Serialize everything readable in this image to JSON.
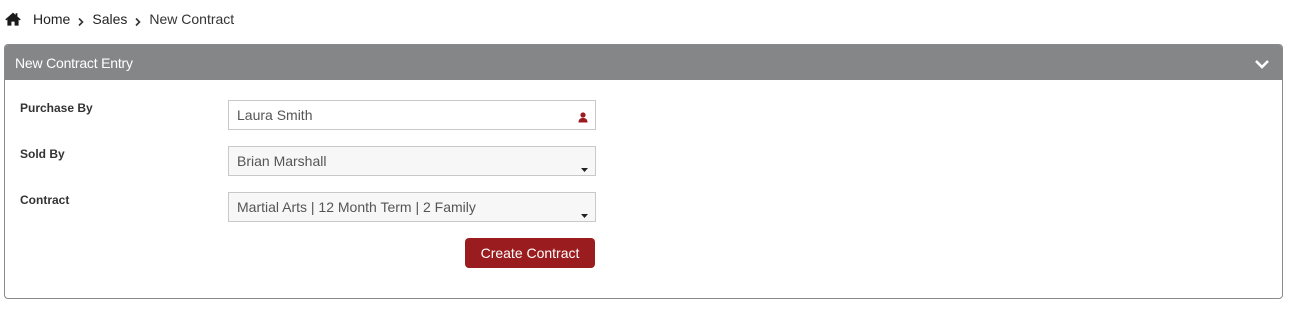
{
  "breadcrumb": {
    "home_icon": "home-icon",
    "separator_icon": "chevron-right-icon",
    "items": [
      "Home",
      "Sales",
      "New Contract"
    ]
  },
  "panel": {
    "title": "New Contract Entry",
    "collapse_icon": "chevron-down-icon",
    "header_color": "#858688"
  },
  "form": {
    "purchase_by": {
      "label": "Purchase By",
      "value": "Laura Smith",
      "icon": "user-icon",
      "icon_color": "#9b1c1f"
    },
    "sold_by": {
      "label": "Sold By",
      "value": "Brian Marshall",
      "icon": "caret-down-icon"
    },
    "contract": {
      "label": "Contract",
      "value": "Martial Arts | 12 Month Term | 2 Family",
      "icon": "caret-down-icon"
    },
    "submit_label": "Create Contract",
    "submit_color": "#9b1c1f"
  }
}
